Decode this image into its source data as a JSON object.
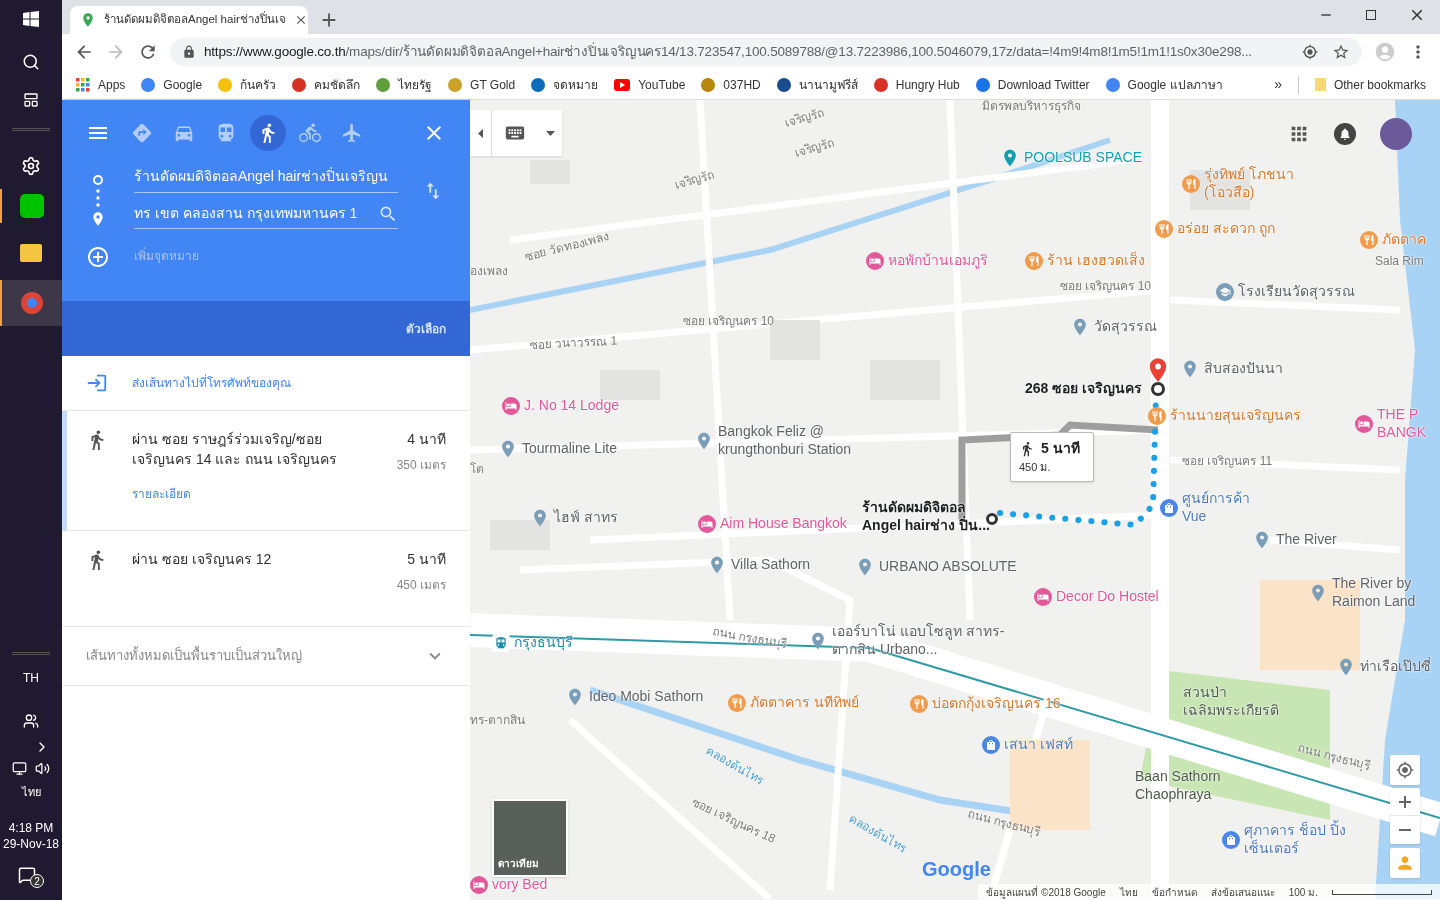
{
  "taskbar": {
    "language": "TH",
    "ime": "ไทย",
    "time": "4:18 PM",
    "date": "29-Nov-18",
    "notifications": "2"
  },
  "browser": {
    "tab_title": "ร้านดัดผมดิจิตอลAngel hairช่างปิ่นเจ",
    "url_host": "https://www.google.co.th",
    "url_path": "/maps/dir/ร้านดัดผมดิจิตอลAngel+hairช่างปิ่นเจริญนคร14/13.723547,100.5089788/@13.7223986,100.5046079,17z/data=!4m9!4m8!1m5!1m1!1s0x30e298...",
    "bookmarks": [
      {
        "label": "Apps",
        "kind": "apps"
      },
      {
        "label": "Google",
        "kind": "google"
      },
      {
        "label": "ก้นครัว",
        "kind": "emoji"
      },
      {
        "label": "คมชัดลึก",
        "kind": "news"
      },
      {
        "label": "ไทยรัฐ",
        "kind": "leaf"
      },
      {
        "label": "GT Gold",
        "kind": "gold"
      },
      {
        "label": "จดหมาย",
        "kind": "mail"
      },
      {
        "label": "YouTube",
        "kind": "youtube"
      },
      {
        "label": "037HD",
        "kind": "tv"
      },
      {
        "label": "นานามูฟรีส์",
        "kind": "film"
      },
      {
        "label": "Hungry Hub",
        "kind": "hat"
      },
      {
        "label": "Download Twitter",
        "kind": "download"
      },
      {
        "label": "Google แปลภาษา",
        "kind": "translate"
      }
    ],
    "overflow": "»",
    "other_bookmarks": "Other bookmarks"
  },
  "directions": {
    "modes": [
      {
        "kind": "best",
        "selected": false
      },
      {
        "kind": "car",
        "selected": false
      },
      {
        "kind": "transit",
        "selected": false
      },
      {
        "kind": "walk",
        "selected": true
      },
      {
        "kind": "bike",
        "selected": false
      },
      {
        "kind": "flight",
        "selected": false
      }
    ],
    "origin": "ร้านดัดผมดิจิตอลAngel hairช่างปิ่นเจริญน",
    "destination": "ทร เขต คลองสาน กรุงเทพมหานคร 1",
    "add_placeholder": "เพิ่มจุดหมาย",
    "options": "ตัวเลือก",
    "send_to_phone": "ส่งเส้นทางไปที่โทรศัพท์ของคุณ",
    "routes": [
      {
        "via": "ผ่าน ซอย ราษฎร์ร่วมเจริญ/ซอย เจริญนคร 14 และ ถนน เจริญนคร",
        "time": "4 นาที",
        "distance": "350 เมตร",
        "details": "รายละเอียด",
        "selected": true
      },
      {
        "via": "ผ่าน ซอย เจริญนคร 12",
        "time": "5 นาที",
        "distance": "450 เมตร",
        "selected": false
      }
    ],
    "elevation_note": "เส้นทางทั้งหมดเป็นพื้นราบเป็นส่วนใหญ่"
  },
  "map": {
    "labels": [
      {
        "text": "มิตรพลบริหารธุรกิจ",
        "kind": "street"
      },
      {
        "text": "เจริญรัถ",
        "kind": "street"
      },
      {
        "text": "เจริญรัถ",
        "kind": "street"
      },
      {
        "text": "เจริญรัถ",
        "kind": "street"
      },
      {
        "text": "ซอย วัดทองเพลง",
        "kind": "street"
      },
      {
        "text": "องเพลง",
        "kind": "street"
      },
      {
        "text": "POOLSUB SPACE",
        "kind": "venue"
      },
      {
        "text": "รุ่งทิพย์ โภชนา (โอวสือ)",
        "kind": "food"
      },
      {
        "text": "อร่อย สะดวก ถูก",
        "kind": "food"
      },
      {
        "text": "ภัตตาค",
        "kind": "food"
      },
      {
        "text": "หอพักบ้านเอมภูริ",
        "kind": "hotel"
      },
      {
        "text": "ร้าน เฮงฮวดเส็ง",
        "kind": "food"
      },
      {
        "text": "Sala Rim",
        "kind": "street"
      },
      {
        "text": "ซอย เจริญนคร 10",
        "kind": "street"
      },
      {
        "text": "โรงเรียนวัดสุวรรณ",
        "kind": "school"
      },
      {
        "text": "ซอย เจริญนคร 10",
        "kind": "street"
      },
      {
        "text": "วัดสุวรรณ",
        "kind": "temple"
      },
      {
        "text": "ซอย วนาวรรณ 1",
        "kind": "street"
      },
      {
        "text": "สิบสองปันนา",
        "kind": "poi"
      },
      {
        "text": "268 ซอย เจริญนคร",
        "kind": "address"
      },
      {
        "text": "ร้านนายสุนเจริญนคร",
        "kind": "food"
      },
      {
        "text": "THE P BANGK",
        "kind": "hotel"
      },
      {
        "text": "J. No 14 Lodge",
        "kind": "hotel"
      },
      {
        "text": "Tourmaline Lite",
        "kind": "poi"
      },
      {
        "text": "Bangkok Feliz @ krungthonburi Station",
        "kind": "poi"
      },
      {
        "text": "ซอย เจริญนคร 11",
        "kind": "street"
      },
      {
        "text": "โต",
        "kind": "street"
      },
      {
        "text": "ไฮฟ์ สาทร",
        "kind": "poi"
      },
      {
        "text": "Aim House Bangkok",
        "kind": "hotel"
      },
      {
        "text": "ร้านดัดผมดิจิตอล Angel hairช่าง ปิ่น...",
        "kind": "address"
      },
      {
        "text": "ศูนย์การค้า Vue",
        "kind": "shop"
      },
      {
        "text": "The River",
        "kind": "poi"
      },
      {
        "text": "Villa Sathorn",
        "kind": "poi"
      },
      {
        "text": "URBANO ABSOLUTE",
        "kind": "poi"
      },
      {
        "text": "Decor Do Hostel",
        "kind": "hotel"
      },
      {
        "text": "The River by Raimon Land",
        "kind": "poi"
      },
      {
        "text": "กรุงธนบุรี",
        "kind": "transit"
      },
      {
        "text": "ถนน กรุงธนบุรี",
        "kind": "street"
      },
      {
        "text": "เออร์บาโน่ แอบโซลูท สาทร-ตากสิน Urbano...",
        "kind": "poi"
      },
      {
        "text": "ท่าเรือเป๊ปซี่",
        "kind": "poi"
      },
      {
        "text": "Ideo Mobi Sathorn",
        "kind": "poi"
      },
      {
        "text": "ภัตตาคาร นทีทิพย์",
        "kind": "food"
      },
      {
        "text": "บ่อตกกุ้งเจริญนคร 16",
        "kind": "food"
      },
      {
        "text": "สวนป่า เฉลิมพระเกียรติ",
        "kind": "park"
      },
      {
        "text": "ทร-ตากสิน",
        "kind": "street"
      },
      {
        "text": "เสนา เฟสท์",
        "kind": "shop"
      },
      {
        "text": "ถนน กรุงธนบุรี",
        "kind": "street"
      },
      {
        "text": "คลองต้นไทร",
        "kind": "canal"
      },
      {
        "text": "Baan Sathorn Chaophraya",
        "kind": "park"
      },
      {
        "text": "ซอย เจริญนคร 18",
        "kind": "street"
      },
      {
        "text": "ถนน กรุงธนบุรี",
        "kind": "street"
      },
      {
        "text": "คลองต้นไทร",
        "kind": "canal"
      },
      {
        "text": "ศุภาคาร ช็อป ปิ้งเซ็นเตอร์",
        "kind": "shop"
      },
      {
        "text": "vory Bed",
        "kind": "hotel"
      }
    ],
    "route_card": {
      "time": "5 นาที",
      "distance": "450 ม."
    },
    "satellite": "ดาวเทียม",
    "logo": "Google",
    "footer": [
      "ข้อมูลแผนที่ ©2018 Google",
      "ไทย",
      "ข้อกำหนด",
      "ส่งข้อเสนอแนะ"
    ],
    "scale": "100 ม."
  }
}
